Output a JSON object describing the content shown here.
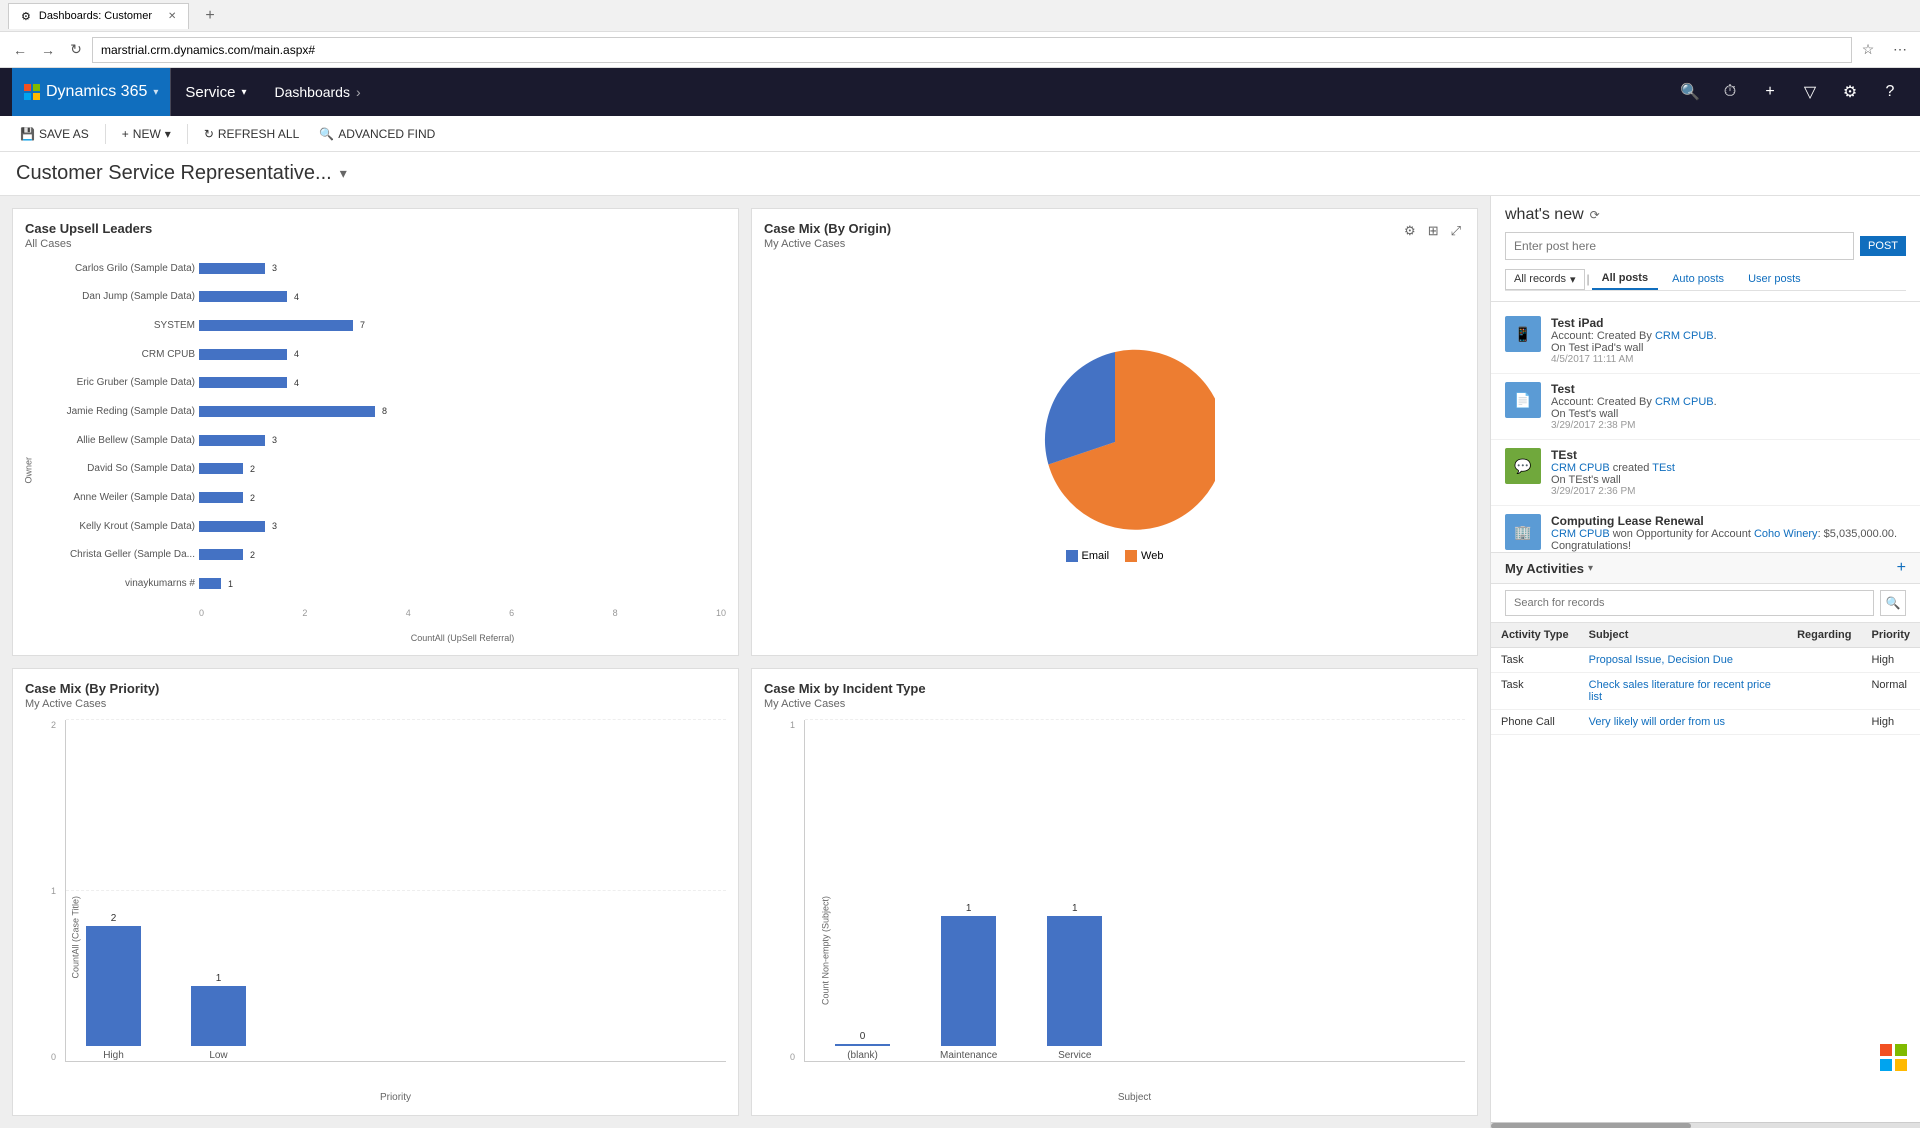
{
  "browser": {
    "tab_label": "Dashboards: Customer",
    "address": "marstrial.crm.dynamics.com/main.aspx#"
  },
  "header": {
    "brand": "Dynamics 365",
    "module": "Service",
    "breadcrumb_item": "Dashboards",
    "breadcrumb_arrow": "›"
  },
  "toolbar": {
    "save_as": "SAVE AS",
    "new": "NEW",
    "refresh_all": "REFRESH ALL",
    "advanced_find": "ADVANCED FIND"
  },
  "page": {
    "title": "Customer Service Representative...",
    "title_caret": "▾"
  },
  "chart1": {
    "title": "Case Upsell Leaders",
    "subtitle": "All Cases",
    "y_axis_label": "Owner",
    "x_axis_label": "CountAll (UpSell Referral)",
    "bars": [
      {
        "label": "Carlos Grilo (Sample Data)",
        "value": 3,
        "max": 10
      },
      {
        "label": "Dan Jump (Sample Data)",
        "value": 4,
        "max": 10
      },
      {
        "label": "SYSTEM",
        "value": 7,
        "max": 10
      },
      {
        "label": "CRM CPUB",
        "value": 4,
        "max": 10
      },
      {
        "label": "Eric Gruber (Sample Data)",
        "value": 4,
        "max": 10
      },
      {
        "label": "Jamie Reding (Sample Data)",
        "value": 8,
        "max": 10
      },
      {
        "label": "Allie Bellew (Sample Data)",
        "value": 3,
        "max": 10
      },
      {
        "label": "David So (Sample Data)",
        "value": 2,
        "max": 10
      },
      {
        "label": "Anne Weiler (Sample Data)",
        "value": 2,
        "max": 10
      },
      {
        "label": "Kelly Krout (Sample Data)",
        "value": 3,
        "max": 10
      },
      {
        "label": "Christa Geller (Sample Da...",
        "value": 2,
        "max": 10
      },
      {
        "label": "vinaykumarns #",
        "value": 1,
        "max": 10
      }
    ],
    "x_ticks": [
      "0",
      "2",
      "4",
      "6",
      "8",
      "10"
    ]
  },
  "chart2": {
    "title": "Case Mix (By Origin)",
    "subtitle": "My Active Cases",
    "legend": [
      {
        "label": "Email",
        "color": "#4472c4"
      },
      {
        "label": "Web",
        "color": "#ed7d31"
      }
    ],
    "email_pct": 25,
    "web_pct": 75
  },
  "chart3": {
    "title": "Case Mix (By Priority)",
    "subtitle": "My Active Cases",
    "x_axis_label": "Priority",
    "y_axis_label": "CountAll (Case Title)",
    "bars": [
      {
        "label": "High",
        "value": 2,
        "height_pct": 90
      },
      {
        "label": "Low",
        "value": 1,
        "height_pct": 45
      }
    ],
    "y_ticks": [
      "2",
      "1",
      "0"
    ]
  },
  "chart4": {
    "title": "Case Mix by Incident Type",
    "subtitle": "My Active Cases",
    "x_axis_label": "Subject",
    "y_axis_label": "Count Non-empty (Subject)",
    "bars": [
      {
        "label": "(blank)",
        "value": 0,
        "height_pct": 2
      },
      {
        "label": "Maintenance",
        "value": 1,
        "height_pct": 85
      },
      {
        "label": "Service",
        "value": 1,
        "height_pct": 85
      }
    ],
    "y_ticks": [
      "1",
      "0"
    ]
  },
  "whats_new": {
    "title": "what's new",
    "post_placeholder": "Enter post here",
    "post_button": "POST",
    "filter_dropdown": "All records",
    "tabs": [
      "All posts",
      "Auto posts",
      "User posts"
    ],
    "active_tab": "All posts",
    "items": [
      {
        "title": "Test iPad",
        "detail1": "Account: Created By",
        "link1": "CRM CPUB",
        "detail2": "On Test iPad's wall",
        "time": "4/5/2017 11:11 AM",
        "icon": "📱"
      },
      {
        "title": "Test",
        "detail1": "Account: Created By",
        "link1": "CRM CPUB",
        "detail2": "On Test's wall",
        "time": "3/29/2017 2:38 PM",
        "icon": "📄"
      },
      {
        "title": "TEst",
        "detail1_link": "CRM CPUB",
        "detail1_text": "created",
        "detail1_link2": "TEst",
        "detail2": "On TEst's wall",
        "time": "3/29/2017 2:36 PM",
        "icon": "💬"
      },
      {
        "title": "Computing Lease Renewal",
        "detail1_link": "CRM CPUB",
        "detail1_text": "won Opportunity for Account",
        "detail1_link2": "Coho Winery",
        "detail1_extra": ": $5,035,000.00. Congratulations!",
        "time": "",
        "icon": "🏢"
      }
    ]
  },
  "my_activities": {
    "title": "My Activities",
    "search_placeholder": "Search for records",
    "add_icon": "+",
    "columns": [
      "Activity Type",
      "Subject",
      "Regarding",
      "Priority"
    ],
    "rows": [
      {
        "type": "Task",
        "subject": "Proposal Issue, Decision Due",
        "regarding": "",
        "priority": "High"
      },
      {
        "type": "Task",
        "subject": "Check sales literature for recent price list",
        "regarding": "",
        "priority": "Normal"
      },
      {
        "type": "Phone Call",
        "subject": "Very likely will order from us",
        "regarding": "",
        "priority": "High"
      }
    ]
  },
  "windows": {
    "colors": [
      "#f25022",
      "#7fba00",
      "#00a4ef",
      "#ffb900"
    ]
  }
}
